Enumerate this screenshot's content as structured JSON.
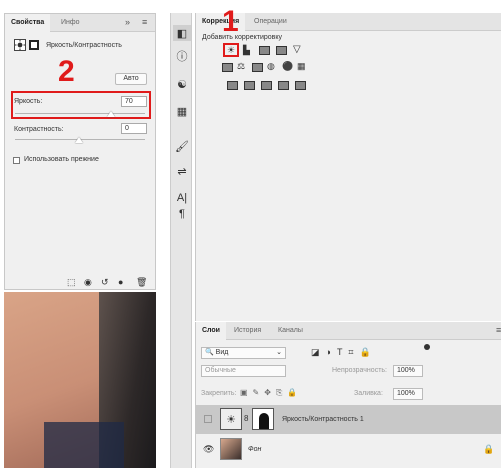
{
  "properties": {
    "tabs": [
      "Свойства",
      "Инфо"
    ],
    "collapse": "»",
    "menu": "≡",
    "adjustment_name": "Яркость/Контрастность",
    "auto_button": "Авто",
    "brightness_label": "Яркость:",
    "brightness_value": "70",
    "contrast_label": "Контрастность:",
    "contrast_value": "0",
    "use_legacy_label": "Использовать прежние"
  },
  "annotations": {
    "label_1": "1",
    "label_2": "2",
    "color": "#e01b1b"
  },
  "adjustments": {
    "tabs": [
      "Коррекция",
      "Операции"
    ],
    "header": "Добавить корректировку"
  },
  "layers": {
    "tabs": [
      "Слои",
      "История",
      "Каналы"
    ],
    "filter_kind": "Вид",
    "blend_mode": "Обычные",
    "opacity_label": "Непрозрачность:",
    "opacity_value": "100%",
    "lock_label": "Закрепить:",
    "fill_label": "Заливка:",
    "fill_value": "100%",
    "rows": [
      {
        "name": "Яркость/Контрастность 1"
      },
      {
        "name": "Фон"
      }
    ]
  },
  "colors": {
    "panel_bg": "#f0f0f0",
    "selected_row": "#c8c8c8",
    "photo_bg": "#4a3f3c"
  }
}
